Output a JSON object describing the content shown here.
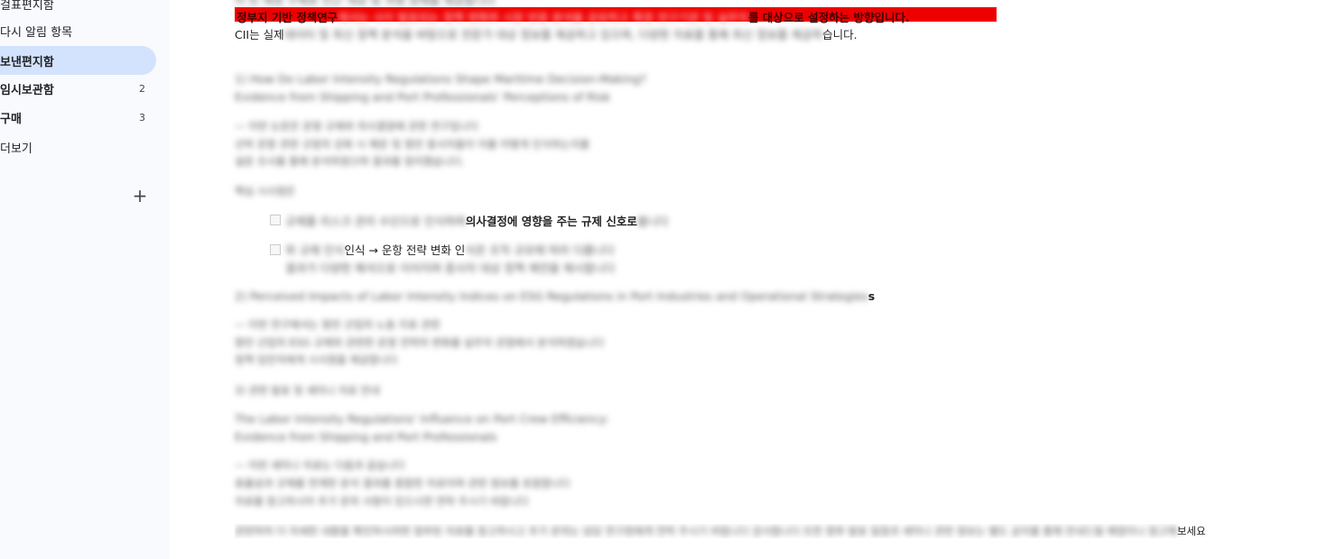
{
  "sidebar": {
    "items": [
      {
        "label": "걸표편지함",
        "count": ""
      },
      {
        "label": "다시 알림 항목",
        "count": ""
      },
      {
        "label": "보낸편지함",
        "count": ""
      },
      {
        "label": "임시보관함",
        "count": "2"
      },
      {
        "label": "구매",
        "count": "3"
      },
      {
        "label": "더보기",
        "count": ""
      }
    ],
    "add_label": "+"
  },
  "email": {
    "top_partial": "이 빈 재정 구제로 인근 개성 및 귀영 정체를 제공합니다",
    "highlight_prefix": "정부지 기반 정책연구",
    "highlight_hidden": "에서는 사이 발표되는 정책 변화와 시장 반응 분석을 공유하고 특정 연구기관 및 실무자",
    "highlight_suffix": "를 대상으로 설정하는 방향입니다.",
    "intro_prefix": "CII는 실제",
    "intro_hidden": "데이터 및 최신 정책 분석을 바탕으로 전문가 대상 정보를 제공하고 있으며, 다양한 자료를 통해 최신 정보를 제공하",
    "intro_suffix": "습니다.",
    "section1_title": "1) How Do Labor Intensity Regulations Shape Maritime Decision-Making?",
    "section1_sub": "Evidence from Shipping and Port Professionals' Perceptions of Risk",
    "section1_p1": "— 이번 논문은 운항 규제와 의사결정에 관한 연구입니다",
    "section1_p2": "선박 운항 관련 규정의 강화 시 해운 및 항만 종사자들이 이를 어떻게 인식하는지를",
    "section1_p3": "설문 조사를 통해 분석하였으며 결과를 정리했습니다.",
    "key_findings": "핵심 시사점은",
    "bullet1_hidden": "규제를 리스크 관리 수단으로 인식하며",
    "bullet1_visible": "의사결정에 영향을 주는 규제 신호로",
    "bullet1_tail": "봅니다",
    "bullet2_hidden_start": "위 규제 인식",
    "bullet2_visible": "인식 → 운항 전략 변화 인",
    "bullet2_hidden_end": "식은 조직 규모에 따라 다릅니다",
    "bullet2_line2": "결과가 다양한 해석으로 이어지며 종사자 대상 정책 제언을 제시합니다",
    "section2_title": "2) Perceived Impacts of Labor Intensity Indices on ESG Regulations in Port Industries and Operational Strategies",
    "section2_tail": "s",
    "section2_p1": "— 이번 연구에서는 항만 산업의 노동 지표 관련",
    "section2_p2": "항만 산업의 ESG 규제와 관련한 운영 전략의 변화를 실무자 관점에서 분석하였습니다",
    "section2_p3": "정책 입안자에게 시사점을 제공합니다",
    "item3": "3) 관련 발표 및 세미나 자료 안내",
    "section3_title": "The Labor Intensity Regulations' Influence on Port Crew Efficiency:",
    "section3_sub": "Evidence from Shipping and Port Professionals",
    "section3_p1": "— 이번 세미나 자료는 다음과 같습니다",
    "section3_p2": "효율성과 규제를 연계한 분석 결과를 종합한 자료이며 관련 정보를 포함합니다",
    "section3_p3": "자료를 참고하시어 추가 문의 사항이 있으시면 연락 주시기 바랍니다",
    "closing_hidden": "관련하여 더 자세한 내용을 확인하시려면 첨부된 자료를 참고하시고 추가 문의는 담당 연구원에게 연락 주시기 바랍니다 감사합니다 또한 향후 발표 일정과 세미나 관련 정보는 별도 공지를 통해 안내드릴 예정이니 참고해",
    "closing_visible": "보세요"
  }
}
